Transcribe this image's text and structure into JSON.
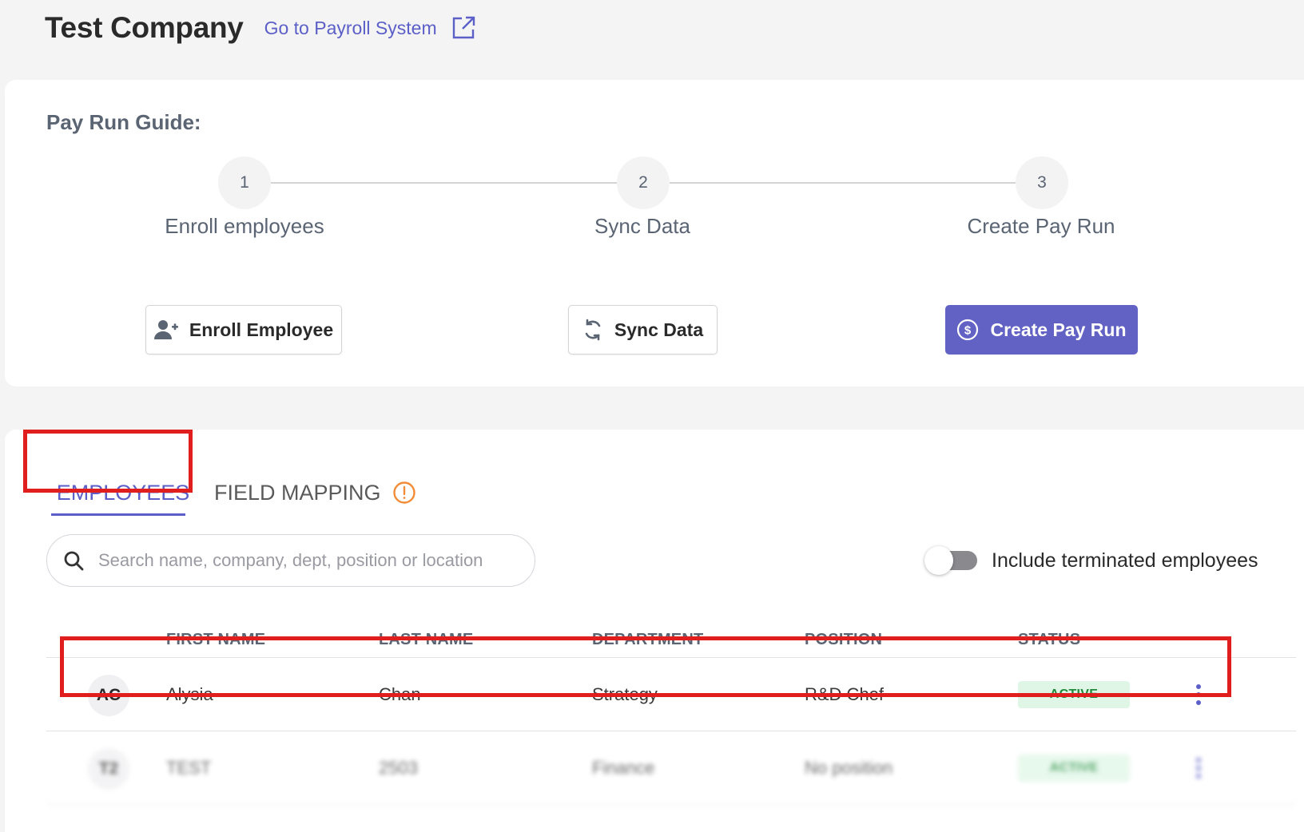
{
  "header": {
    "company_name": "Test Company",
    "payroll_link_label": "Go to Payroll System",
    "payroll_link_icon": "external-link-icon"
  },
  "guide": {
    "title": "Pay Run Guide:",
    "steps": [
      {
        "number": "1",
        "label": "Enroll employees",
        "button_label": "Enroll Employee",
        "button_icon": "add-user-icon"
      },
      {
        "number": "2",
        "label": "Sync Data",
        "button_label": "Sync Data",
        "button_icon": "sync-icon"
      },
      {
        "number": "3",
        "label": "Create Pay Run",
        "button_label": "Create Pay Run",
        "button_icon": "dollar-circle-icon"
      }
    ]
  },
  "tabs": {
    "employees": "EMPLOYEES",
    "field_mapping": "FIELD MAPPING",
    "field_mapping_icon": "warning-circle-icon"
  },
  "search": {
    "placeholder": "Search name, company, dept, position or location",
    "value": ""
  },
  "toggle": {
    "label": "Include terminated employees",
    "on": false
  },
  "table": {
    "columns": [
      "FIRST NAME",
      "LAST NAME",
      "DEPARTMENT",
      "POSITION",
      "STATUS"
    ],
    "rows": [
      {
        "initials": "AC",
        "first_name": "Alysia",
        "last_name": "Chan",
        "department": "Strategy",
        "position": "R&D Chef",
        "status": "ACTIVE"
      },
      {
        "initials": "T2",
        "first_name": "TEST",
        "last_name": "2503",
        "department": "Finance",
        "position": "No position",
        "status": "ACTIVE"
      }
    ]
  },
  "colors": {
    "accent": "#5b5fc7",
    "primary_button": "#6162c4",
    "status_active_bg": "#dff6e6",
    "status_active_text": "#1f8a3a",
    "warning": "#f28c38",
    "highlight": "#e01e1e"
  }
}
